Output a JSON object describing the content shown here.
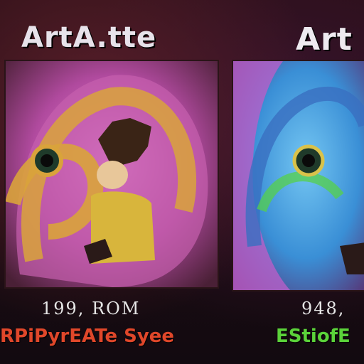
{
  "panels": [
    {
      "title": "ArtA.tte",
      "caption": "199, ROM",
      "subtitle": "RPiPyrEATe Syee",
      "colors": {
        "title": "#e7e2ea",
        "caption": "#e6e6e6",
        "subtitle": "#e0472a",
        "art_primary": "#d66ec2",
        "art_secondary": "#d9a33b"
      }
    },
    {
      "title": "Art",
      "caption": "948,",
      "subtitle": "EStiofE",
      "colors": {
        "title": "#eeeaf0",
        "caption": "#e6e6e6",
        "subtitle": "#5bd23a",
        "art_primary": "#3a8fd6",
        "art_secondary": "#b85fc8"
      }
    }
  ]
}
